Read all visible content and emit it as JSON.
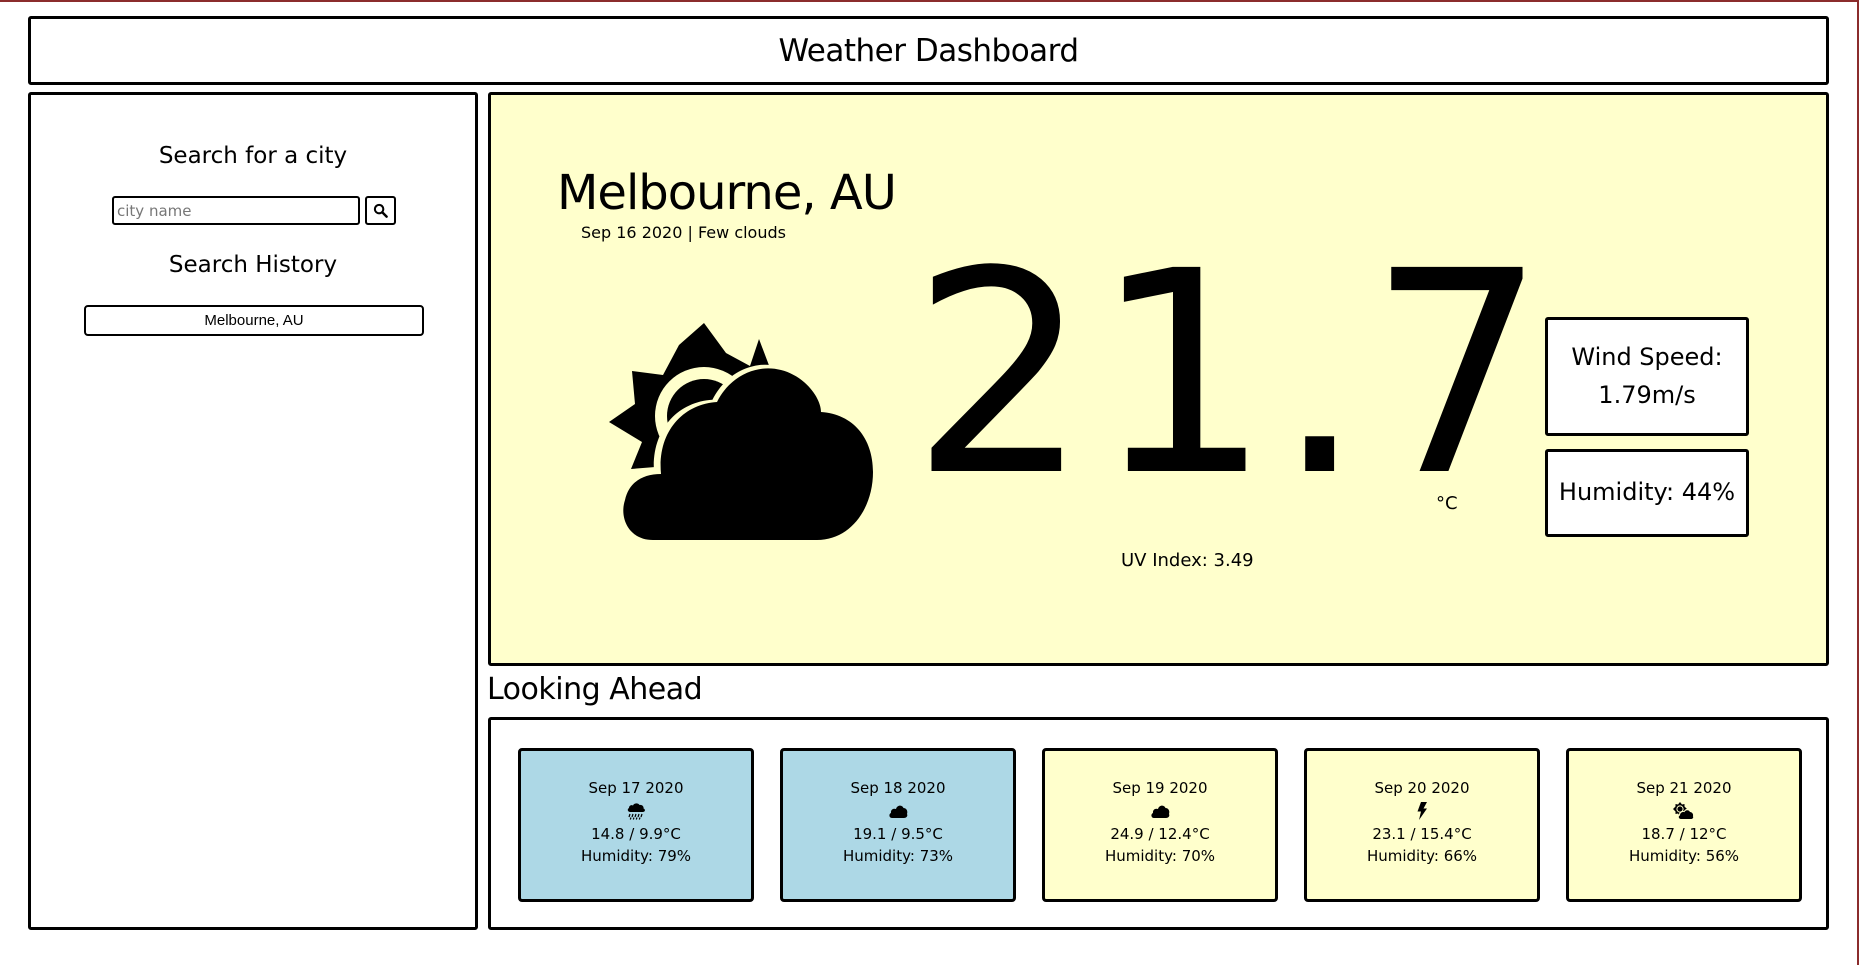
{
  "header": {
    "title": "Weather Dashboard"
  },
  "sidebar": {
    "search_title": "Search for a city",
    "search_placeholder": "city name",
    "search_value": "",
    "history_title": "Search History",
    "history": [
      {
        "label": "Melbourne, AU"
      }
    ]
  },
  "current": {
    "city": "Melbourne, AU",
    "date_line": "Sep 16 2020 | Few clouds",
    "icon": "sun-behind-cloud-icon",
    "temperature": "21.7",
    "unit": "°C",
    "uv_index": "UV Index: 3.49",
    "wind_label": "Wind Speed:",
    "wind_value": "1.79m/s",
    "humidity": "Humidity: 44%"
  },
  "ahead_title": "Looking Ahead",
  "forecast": [
    {
      "date": "Sep 17 2020",
      "icon": "rain-cloud-icon",
      "temp": "14.8 / 9.9°C",
      "humidity": "Humidity: 79%",
      "color": "#add8e6"
    },
    {
      "date": "Sep 18 2020",
      "icon": "cloud-icon",
      "temp": "19.1 / 9.5°C",
      "humidity": "Humidity: 73%",
      "color": "#add8e6"
    },
    {
      "date": "Sep 19 2020",
      "icon": "cloud-icon",
      "temp": "24.9 / 12.4°C",
      "humidity": "Humidity: 70%",
      "color": "#ffffcc"
    },
    {
      "date": "Sep 20 2020",
      "icon": "lightning-icon",
      "temp": "23.1 / 15.4°C",
      "humidity": "Humidity: 66%",
      "color": "#ffffcc"
    },
    {
      "date": "Sep 21 2020",
      "icon": "sun-behind-cloud-icon",
      "temp": "18.7 / 12°C",
      "humidity": "Humidity: 56%",
      "color": "#ffffcc"
    }
  ],
  "colors": {
    "current_bg": "#ffffcc",
    "cool_card": "#add8e6",
    "warm_card": "#ffffcc",
    "border": "#000000"
  }
}
